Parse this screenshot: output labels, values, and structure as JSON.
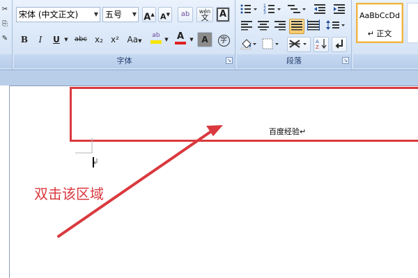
{
  "ribbon": {
    "font_group": {
      "label": "字体",
      "font_name": "宋体 (中文正文)",
      "font_size": "五号",
      "grow_font": "A",
      "shrink_font": "A",
      "phonetic_glyph": "ab",
      "pinyin_glyph": "wén",
      "pinyin_char": "文",
      "char_border": "A",
      "bold": "B",
      "italic": "I",
      "underline": "U",
      "strikethrough": "abc",
      "subscript": "x₂",
      "superscript": "x²",
      "change_case": "Aa",
      "highlight": "ab",
      "font_color": "A",
      "char_shading": "A",
      "enclose_char": "字"
    },
    "paragraph_group": {
      "label": "段落"
    },
    "styles_group": {
      "sample": "AaBbCcDd",
      "style_name": "↵ 正文"
    }
  },
  "document": {
    "header_text": "百度经验↵",
    "cursor": "↵"
  },
  "annotation": {
    "text": "双击该区域"
  },
  "colors": {
    "annotation_red": "#d9393e",
    "ribbon_blue": "#dbe8f8",
    "highlight_yellow": "#f5e500",
    "font_color_red": "#e02020"
  }
}
